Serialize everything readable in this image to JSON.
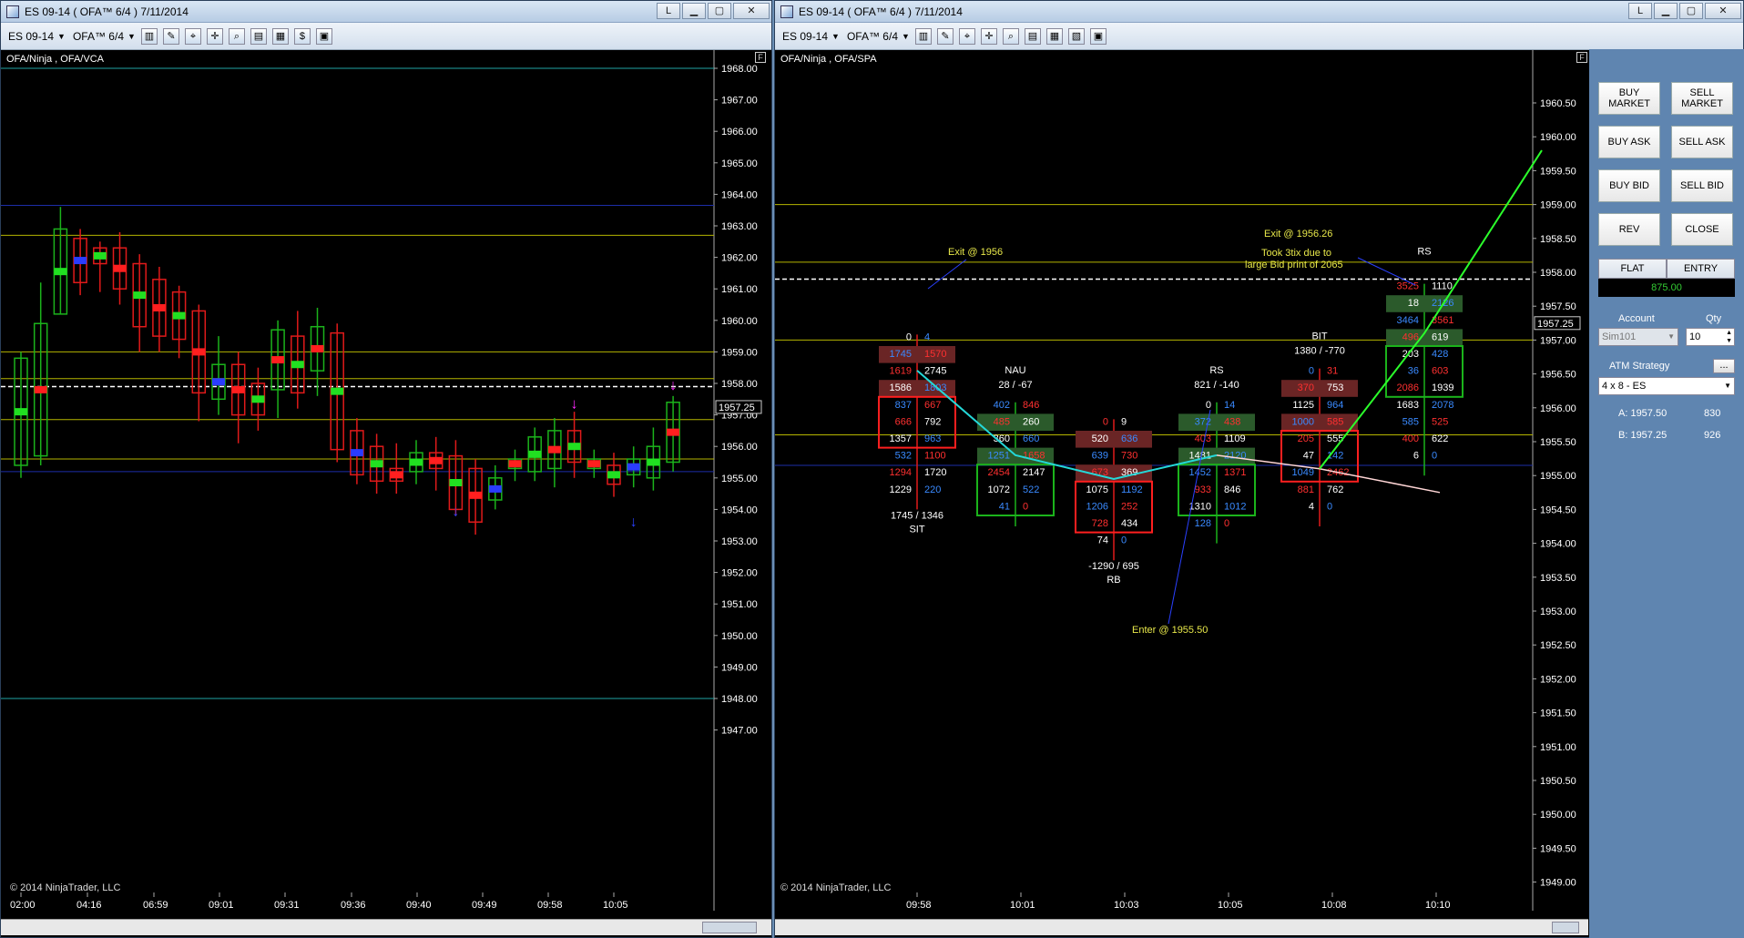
{
  "left_window": {
    "title": "ES 09-14 ( OFA™ 6/4 )  7/11/2014",
    "restore_btn": "L",
    "toolbar": {
      "instrument": "ES 09-14",
      "period": "OFA™ 6/4"
    },
    "chart_label": "OFA/Ninja , OFA/VCA",
    "copyright": "© 2014 NinjaTrader, LLC",
    "price_marker": "1957.25",
    "y_ticks": [
      "1968.00",
      "1967.00",
      "1966.00",
      "1965.00",
      "1964.00",
      "1963.00",
      "1962.00",
      "1961.00",
      "1960.00",
      "1959.00",
      "1958.00",
      "1957.00",
      "1956.00",
      "1955.00",
      "1954.00",
      "1953.00",
      "1952.00",
      "1951.00",
      "1950.00",
      "1949.00",
      "1948.00",
      "1947.00"
    ],
    "x_ticks": [
      "02:00",
      "04:16",
      "06:59",
      "09:01",
      "09:31",
      "09:36",
      "09:40",
      "09:49",
      "09:58",
      "10:05"
    ]
  },
  "right_window": {
    "title": "ES 09-14 ( OFA™ 6/4 )  7/11/2014",
    "restore_btn": "L",
    "toolbar": {
      "instrument": "ES 09-14",
      "period": "OFA™ 6/4"
    },
    "chart_label": "OFA/Ninja , OFA/SPA",
    "copyright": "© 2014 NinjaTrader, LLC",
    "price_marker": "1957.25",
    "y_ticks": [
      "1960.50",
      "1960.00",
      "1959.50",
      "1959.00",
      "1958.50",
      "1958.00",
      "1957.50",
      "1957.00",
      "1956.50",
      "1956.00",
      "1955.50",
      "1955.00",
      "1954.50",
      "1954.00",
      "1953.50",
      "1953.00",
      "1952.50",
      "1952.00",
      "1951.50",
      "1951.00",
      "1950.50",
      "1950.00",
      "1949.50",
      "1949.00"
    ],
    "x_ticks": [
      "09:58",
      "10:01",
      "10:03",
      "10:05",
      "10:08",
      "10:10"
    ],
    "annotations": {
      "exit1": "Exit @ 1956",
      "exit2": "Exit @ 1956.26",
      "took1": "Took 3tix due to",
      "took2": "large Bid print of 2065",
      "enter": "Enter @ 1955.50"
    },
    "bars": [
      {
        "label": "",
        "delta": "1745 / 1346",
        "tag": "SIT",
        "rows": [
          [
            "0",
            "4"
          ],
          [
            "1745",
            "1570"
          ],
          [
            "1619",
            "2745"
          ],
          [
            "1586",
            "1803"
          ],
          [
            "837",
            "667"
          ],
          [
            "666",
            "792"
          ],
          [
            "1357",
            "963"
          ],
          [
            "532",
            "1100"
          ],
          [
            "1294",
            "1720"
          ],
          [
            "1229",
            "220"
          ]
        ]
      },
      {
        "label": "NAU",
        "delta": "28 / -67",
        "tag": "",
        "rows": [
          [
            "402",
            "846"
          ],
          [
            "485",
            "260"
          ],
          [
            "360",
            "660"
          ],
          [
            "1251",
            "1658"
          ],
          [
            "2454",
            "2147"
          ],
          [
            "1072",
            "522"
          ],
          [
            "41",
            "0"
          ]
        ]
      },
      {
        "label": "",
        "delta": "-1290 / 695",
        "tag": "RB",
        "rows": [
          [
            "0",
            "9"
          ],
          [
            "520",
            "636"
          ],
          [
            "639",
            "730"
          ],
          [
            "673",
            "369"
          ],
          [
            "1075",
            "1192"
          ],
          [
            "1206",
            "252"
          ],
          [
            "728",
            "434"
          ],
          [
            "74",
            "0"
          ]
        ]
      },
      {
        "label": "RS",
        "delta": "821 / -140",
        "tag": "",
        "rows": [
          [
            "0",
            "14"
          ],
          [
            "372",
            "438"
          ],
          [
            "403",
            "1109"
          ],
          [
            "1481",
            "2120"
          ],
          [
            "1452",
            "1371"
          ],
          [
            "933",
            "846"
          ],
          [
            "1310",
            "1012"
          ],
          [
            "128",
            "0"
          ]
        ]
      },
      {
        "label": "BIT",
        "delta": "1380 / -770",
        "tag": "",
        "rows": [
          [
            "0",
            "31"
          ],
          [
            "370",
            "753"
          ],
          [
            "1125",
            "964"
          ],
          [
            "1000",
            "585"
          ],
          [
            "205",
            "555"
          ],
          [
            "47",
            "142"
          ],
          [
            "1049",
            "2462"
          ],
          [
            "881",
            "762"
          ],
          [
            "4",
            "0"
          ]
        ]
      },
      {
        "label": "RS",
        "delta": "",
        "tag": "",
        "rows": [
          [
            "3525",
            "1110"
          ],
          [
            "18",
            "2126"
          ],
          [
            "3464",
            "3561"
          ],
          [
            "496",
            "619"
          ],
          [
            "203",
            "428"
          ],
          [
            "36",
            "603"
          ],
          [
            "2086",
            "1939"
          ],
          [
            "1683",
            "2078"
          ],
          [
            "585",
            "525"
          ],
          [
            "400",
            "622"
          ],
          [
            "6",
            "0"
          ]
        ]
      }
    ]
  },
  "trade_panel": {
    "buy_market": "BUY MARKET",
    "sell_market": "SELL MARKET",
    "buy_ask": "BUY ASK",
    "sell_ask": "SELL ASK",
    "buy_bid": "BUY BID",
    "sell_bid": "SELL BID",
    "rev": "REV",
    "close": "CLOSE",
    "flat": "FLAT",
    "entry": "ENTRY",
    "pnl": "875.00",
    "account_label": "Account",
    "qty_label": "Qty",
    "account_value": "Sim101",
    "qty_value": "10",
    "atm_label": "ATM Strategy",
    "atm_btn": "...",
    "atm_value": "4 x 8 - ES",
    "ask_label": "A:  1957.50",
    "ask_size": "830",
    "bid_label": "B:  1957.25",
    "bid_size": "926"
  }
}
